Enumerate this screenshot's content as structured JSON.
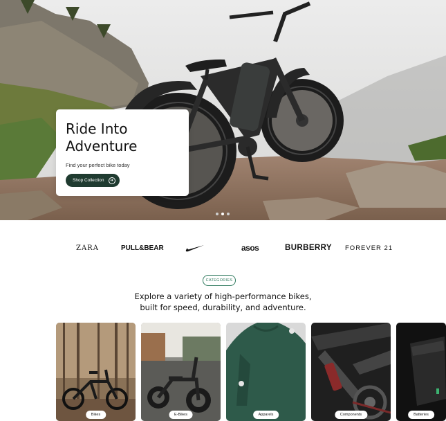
{
  "hero": {
    "title_line1": "Ride Into",
    "title_line2": "Adventure",
    "subtitle": "Find your perfect bike today",
    "cta_label": "Shop Collection",
    "cta_icon": "arrow-right-circle-icon",
    "slides_total": 3,
    "active_slide": 2
  },
  "brands": {
    "zara": "ZARA",
    "pull_bear": "PULL&BEAR",
    "nike": "nike-swoosh-logo",
    "asos": "asos",
    "burberry": "BURBERRY",
    "forever21": "FOREVER 21"
  },
  "categories": {
    "badge": "CATEGORIES",
    "heading_line1": "Explore a variety of high-performance bikes,",
    "heading_line2": "built for speed, durability, and adventure.",
    "items": [
      {
        "label": "Bikes"
      },
      {
        "label": "E-Bikes"
      },
      {
        "label": "Apparels"
      },
      {
        "label": "Components"
      },
      {
        "label": "Batteries"
      }
    ]
  },
  "colors": {
    "accent_dark_green": "#1f3b30",
    "accent_green": "#2f7a5e"
  }
}
